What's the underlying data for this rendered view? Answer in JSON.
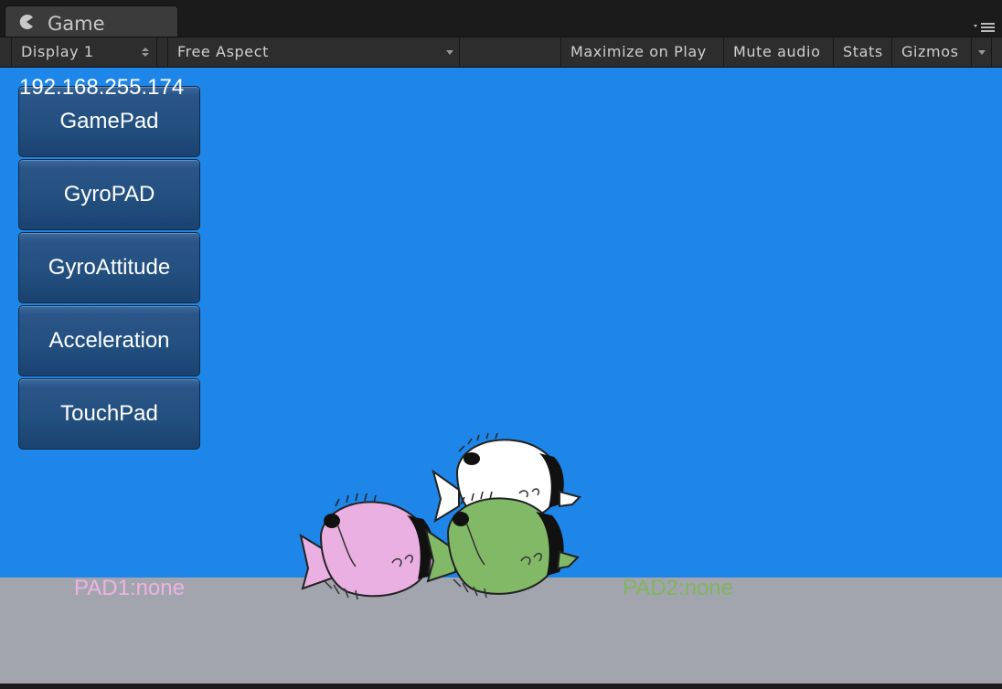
{
  "tab": {
    "title": "Game",
    "icon": "pacman-icon",
    "menu_icon": "panel-menu-icon"
  },
  "toolbar": {
    "display": "Display 1",
    "aspect": "Free Aspect",
    "maximize_on_play": "Maximize on Play",
    "mute_audio": "Mute audio",
    "stats": "Stats",
    "gizmos": "Gizmos"
  },
  "game": {
    "ip_address": "192.168.255.174",
    "buttons": [
      "GamePad",
      "GyroPAD",
      "GyroAttitude",
      "Acceleration",
      "TouchPad"
    ],
    "pad1_status": "PAD1:none",
    "pad2_status": "PAD2:none",
    "colors": {
      "sky": "#1e86e8",
      "ground": "#a3a5ae",
      "fish_pink": "#eab0e2",
      "fish_green": "#82b967",
      "fish_white": "#ffffff"
    },
    "fish": [
      "pink-fish",
      "white-fish",
      "green-fish"
    ]
  }
}
